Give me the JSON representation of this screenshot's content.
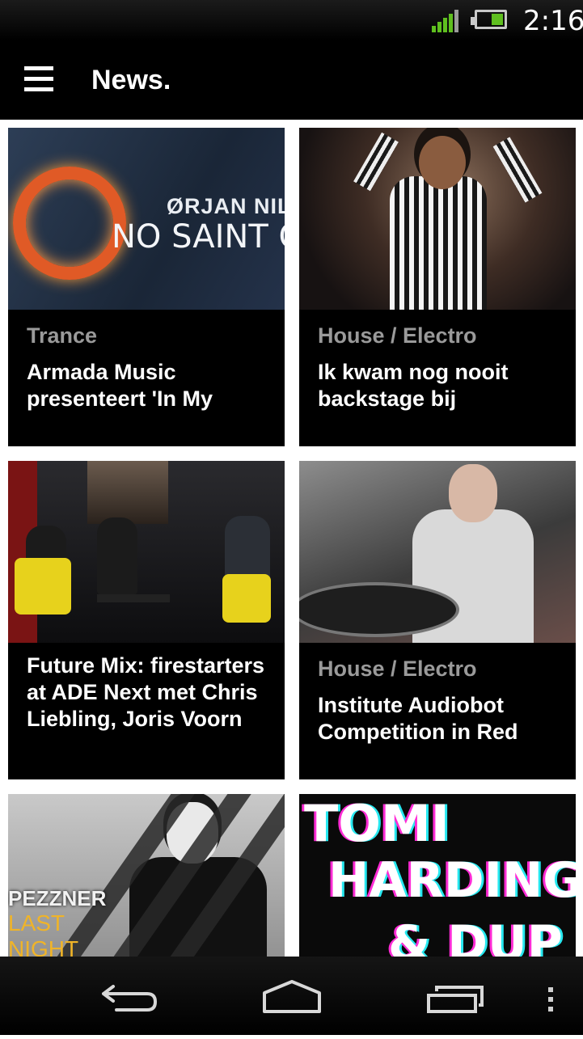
{
  "status_bar": {
    "time": "2:16",
    "signal_icon": "signal-icon",
    "battery_icon": "battery-icon",
    "accent": "#5fbf1f"
  },
  "app_bar": {
    "title": "News.",
    "menu_icon": "hamburger-menu-icon"
  },
  "articles": [
    {
      "category": "Trance",
      "headline": "Armada Music presenteert 'In My Opinion'",
      "image_text": [
        "ØRJAN NIL",
        "NO SAINT OUT"
      ]
    },
    {
      "category": "House / Electro",
      "headline": "Ik kwam nog nooit backstage bij Backstage"
    },
    {
      "category": "",
      "headline": "Future Mix: firestarters at ADE Next met Chris Liebling, Joris Voorn"
    },
    {
      "category": "House / Electro",
      "headline": "Institute Audiobot Competition in Red Bull Studios tijdens ADE"
    },
    {
      "image_text": [
        "PEZZNER",
        "LAST",
        "NIGHT"
      ]
    },
    {
      "image_text": [
        "TOMI",
        "HARDING",
        "& DUP"
      ]
    }
  ],
  "nav_bar": {
    "back_icon": "back-icon",
    "home_icon": "home-icon",
    "recent_icon": "recent-apps-icon",
    "overflow_icon": "overflow-menu-icon"
  }
}
